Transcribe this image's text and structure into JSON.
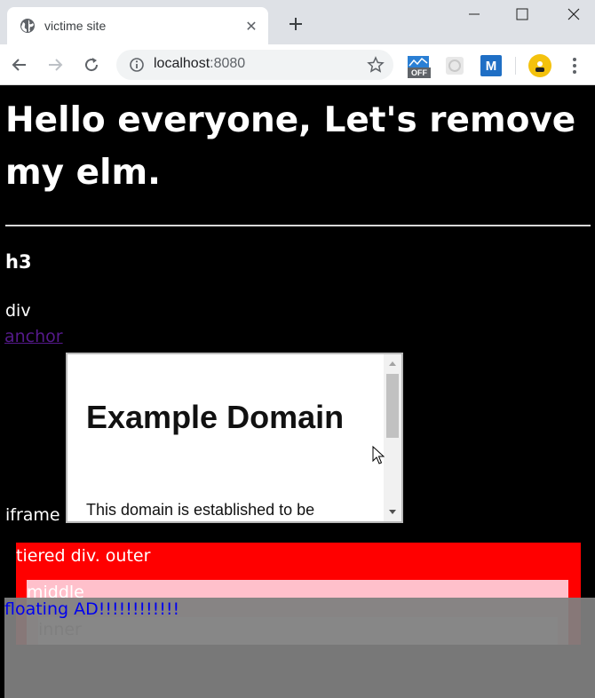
{
  "browser": {
    "tab_title": "victime site",
    "tab_close": "✕",
    "new_tab": "+",
    "url_host": "localhost",
    "url_port": ":8080",
    "extensions": [
      "OFF",
      "M"
    ]
  },
  "page": {
    "h1": "Hello everyone, Let's remove my elm.",
    "h3": "h3",
    "div_text": "div",
    "anchor_text": "anchor",
    "iframe_label": "iframe",
    "iframe": {
      "heading": "Example Domain",
      "paragraph": "This domain is established to be"
    },
    "tiered": {
      "outer": "tiered div. outer",
      "middle": "middle",
      "inner": "inner"
    },
    "floating_ad": "floating AD!!!!!!!!!!!!"
  },
  "colors": {
    "page_bg": "#000000",
    "outer_bg": "#ff0000",
    "middle_bg": "#ffc0cb",
    "inner_bg": "#ffffff",
    "ad_bg": "#808080",
    "ad_text": "#0000ee",
    "anchor": "#551a8b"
  }
}
